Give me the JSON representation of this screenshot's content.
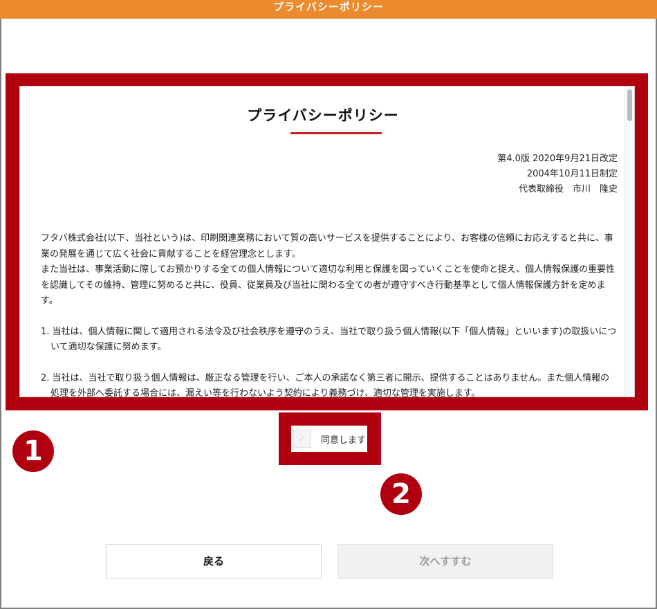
{
  "header": {
    "title": "プライバシーポリシー"
  },
  "policy": {
    "title": "プライバシーポリシー",
    "meta": [
      "第4.0版 2020年9月21日改定",
      "2004年10月11日制定",
      "代表取締役　市川　隆史"
    ],
    "intro_1": "フタバ株式会社(以下、当社という)は、印刷関連業務において質の高いサービスを提供することにより、お客様の信頼にお応えすると共に、事業の発展を通じて広く社会に貢献することを経営理念とします。",
    "intro_2": "また当社は、事業活動に際してお預かりする全ての個人情報について適切な利用と保護を図っていくことを使命と捉え、個人情報保護の重要性を認識してその維持、管理に努めると共に、役員、従業員及び当社に関わる全ての者が遵守すべき行動基準として個人情報保護方針を定めます。",
    "items": [
      "1. 当社は、個人情報に関して適用される法令及び社会秩序を遵守のうえ、当社で取り扱う個人情報(以下「個人情報」といいます)の取扱いについて適切な保護に努めます。",
      "2. 当社は、当社で取り扱う個人情報は、厳正なる管理を行い、ご本人の承諾なく第三者に開示、提供することはありません。また個人情報の処理を外部へ委託する場合には、漏えい等を行わないよう契約により義務づけ、適切な管理を実施します。"
    ]
  },
  "agree": {
    "label": "同意します",
    "checked": false
  },
  "badges": {
    "one": "❶",
    "two": "❷"
  },
  "buttons": {
    "back": "戻る",
    "next": "次へすすむ"
  },
  "colors": {
    "header": "#ec8b2e",
    "highlight": "#b00010",
    "title_rule": "#cc1d1d"
  }
}
